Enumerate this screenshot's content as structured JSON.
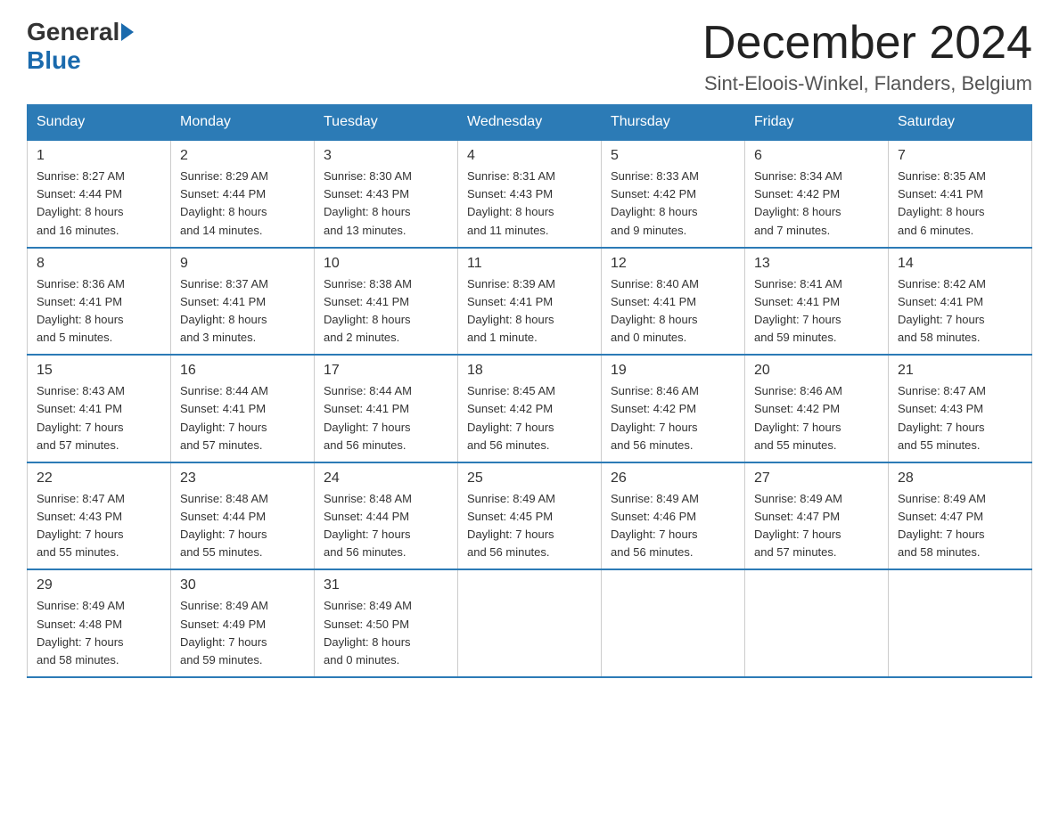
{
  "logo": {
    "general": "General",
    "blue": "Blue"
  },
  "title": "December 2024",
  "subtitle": "Sint-Eloois-Winkel, Flanders, Belgium",
  "days_of_week": [
    "Sunday",
    "Monday",
    "Tuesday",
    "Wednesday",
    "Thursday",
    "Friday",
    "Saturday"
  ],
  "weeks": [
    [
      {
        "num": "1",
        "info": "Sunrise: 8:27 AM\nSunset: 4:44 PM\nDaylight: 8 hours\nand 16 minutes."
      },
      {
        "num": "2",
        "info": "Sunrise: 8:29 AM\nSunset: 4:44 PM\nDaylight: 8 hours\nand 14 minutes."
      },
      {
        "num": "3",
        "info": "Sunrise: 8:30 AM\nSunset: 4:43 PM\nDaylight: 8 hours\nand 13 minutes."
      },
      {
        "num": "4",
        "info": "Sunrise: 8:31 AM\nSunset: 4:43 PM\nDaylight: 8 hours\nand 11 minutes."
      },
      {
        "num": "5",
        "info": "Sunrise: 8:33 AM\nSunset: 4:42 PM\nDaylight: 8 hours\nand 9 minutes."
      },
      {
        "num": "6",
        "info": "Sunrise: 8:34 AM\nSunset: 4:42 PM\nDaylight: 8 hours\nand 7 minutes."
      },
      {
        "num": "7",
        "info": "Sunrise: 8:35 AM\nSunset: 4:41 PM\nDaylight: 8 hours\nand 6 minutes."
      }
    ],
    [
      {
        "num": "8",
        "info": "Sunrise: 8:36 AM\nSunset: 4:41 PM\nDaylight: 8 hours\nand 5 minutes."
      },
      {
        "num": "9",
        "info": "Sunrise: 8:37 AM\nSunset: 4:41 PM\nDaylight: 8 hours\nand 3 minutes."
      },
      {
        "num": "10",
        "info": "Sunrise: 8:38 AM\nSunset: 4:41 PM\nDaylight: 8 hours\nand 2 minutes."
      },
      {
        "num": "11",
        "info": "Sunrise: 8:39 AM\nSunset: 4:41 PM\nDaylight: 8 hours\nand 1 minute."
      },
      {
        "num": "12",
        "info": "Sunrise: 8:40 AM\nSunset: 4:41 PM\nDaylight: 8 hours\nand 0 minutes."
      },
      {
        "num": "13",
        "info": "Sunrise: 8:41 AM\nSunset: 4:41 PM\nDaylight: 7 hours\nand 59 minutes."
      },
      {
        "num": "14",
        "info": "Sunrise: 8:42 AM\nSunset: 4:41 PM\nDaylight: 7 hours\nand 58 minutes."
      }
    ],
    [
      {
        "num": "15",
        "info": "Sunrise: 8:43 AM\nSunset: 4:41 PM\nDaylight: 7 hours\nand 57 minutes."
      },
      {
        "num": "16",
        "info": "Sunrise: 8:44 AM\nSunset: 4:41 PM\nDaylight: 7 hours\nand 57 minutes."
      },
      {
        "num": "17",
        "info": "Sunrise: 8:44 AM\nSunset: 4:41 PM\nDaylight: 7 hours\nand 56 minutes."
      },
      {
        "num": "18",
        "info": "Sunrise: 8:45 AM\nSunset: 4:42 PM\nDaylight: 7 hours\nand 56 minutes."
      },
      {
        "num": "19",
        "info": "Sunrise: 8:46 AM\nSunset: 4:42 PM\nDaylight: 7 hours\nand 56 minutes."
      },
      {
        "num": "20",
        "info": "Sunrise: 8:46 AM\nSunset: 4:42 PM\nDaylight: 7 hours\nand 55 minutes."
      },
      {
        "num": "21",
        "info": "Sunrise: 8:47 AM\nSunset: 4:43 PM\nDaylight: 7 hours\nand 55 minutes."
      }
    ],
    [
      {
        "num": "22",
        "info": "Sunrise: 8:47 AM\nSunset: 4:43 PM\nDaylight: 7 hours\nand 55 minutes."
      },
      {
        "num": "23",
        "info": "Sunrise: 8:48 AM\nSunset: 4:44 PM\nDaylight: 7 hours\nand 55 minutes."
      },
      {
        "num": "24",
        "info": "Sunrise: 8:48 AM\nSunset: 4:44 PM\nDaylight: 7 hours\nand 56 minutes."
      },
      {
        "num": "25",
        "info": "Sunrise: 8:49 AM\nSunset: 4:45 PM\nDaylight: 7 hours\nand 56 minutes."
      },
      {
        "num": "26",
        "info": "Sunrise: 8:49 AM\nSunset: 4:46 PM\nDaylight: 7 hours\nand 56 minutes."
      },
      {
        "num": "27",
        "info": "Sunrise: 8:49 AM\nSunset: 4:47 PM\nDaylight: 7 hours\nand 57 minutes."
      },
      {
        "num": "28",
        "info": "Sunrise: 8:49 AM\nSunset: 4:47 PM\nDaylight: 7 hours\nand 58 minutes."
      }
    ],
    [
      {
        "num": "29",
        "info": "Sunrise: 8:49 AM\nSunset: 4:48 PM\nDaylight: 7 hours\nand 58 minutes."
      },
      {
        "num": "30",
        "info": "Sunrise: 8:49 AM\nSunset: 4:49 PM\nDaylight: 7 hours\nand 59 minutes."
      },
      {
        "num": "31",
        "info": "Sunrise: 8:49 AM\nSunset: 4:50 PM\nDaylight: 8 hours\nand 0 minutes."
      },
      {
        "num": "",
        "info": ""
      },
      {
        "num": "",
        "info": ""
      },
      {
        "num": "",
        "info": ""
      },
      {
        "num": "",
        "info": ""
      }
    ]
  ]
}
